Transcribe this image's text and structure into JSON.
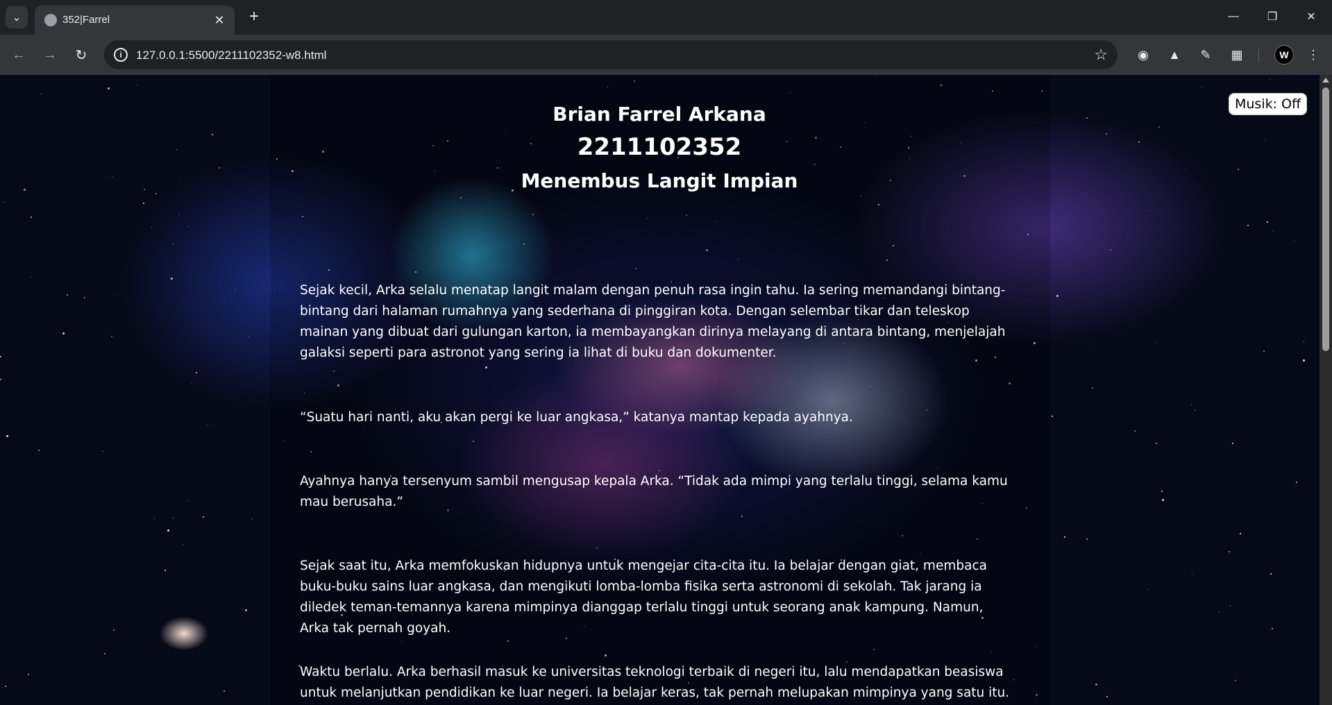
{
  "browser": {
    "tab_title": "352|Farrel",
    "url": "127.0.0.1:5500/2211102352-w8.html"
  },
  "page": {
    "name": "Brian Farrel Arkana",
    "nim": "2211102352",
    "title": "Menembus Langit Impian",
    "music_button": "Musik: Off",
    "paragraphs": [
      "Sejak kecil, Arka selalu menatap langit malam dengan penuh rasa ingin tahu. Ia sering memandangi bintang-bintang dari halaman rumahnya yang sederhana di pinggiran kota. Dengan selembar tikar dan teleskop mainan yang dibuat dari gulungan karton, ia membayangkan dirinya melayang di antara bintang, menjelajah galaksi seperti para astronot yang sering ia lihat di buku dan dokumenter.",
      "“Suatu hari nanti, aku akan pergi ke luar angkasa,” katanya mantap kepada ayahnya.",
      "Ayahnya hanya tersenyum sambil mengusap kepala Arka. “Tidak ada mimpi yang terlalu tinggi, selama kamu mau berusaha.”",
      "Sejak saat itu, Arka memfokuskan hidupnya untuk mengejar cita-cita itu. Ia belajar dengan giat, membaca buku-buku sains luar angkasa, dan mengikuti lomba-lomba fisika serta astronomi di sekolah. Tak jarang ia diledek teman-temannya karena mimpinya dianggap terlalu tinggi untuk seorang anak kampung. Namun, Arka tak pernah goyah.",
      "Waktu berlalu. Arka berhasil masuk ke universitas teknologi terbaik di negeri itu, lalu mendapatkan beasiswa untuk melanjutkan pendidikan ke luar negeri. Ia belajar keras, tak pernah melupakan mimpinya yang satu itu. Setiap malam"
    ]
  }
}
